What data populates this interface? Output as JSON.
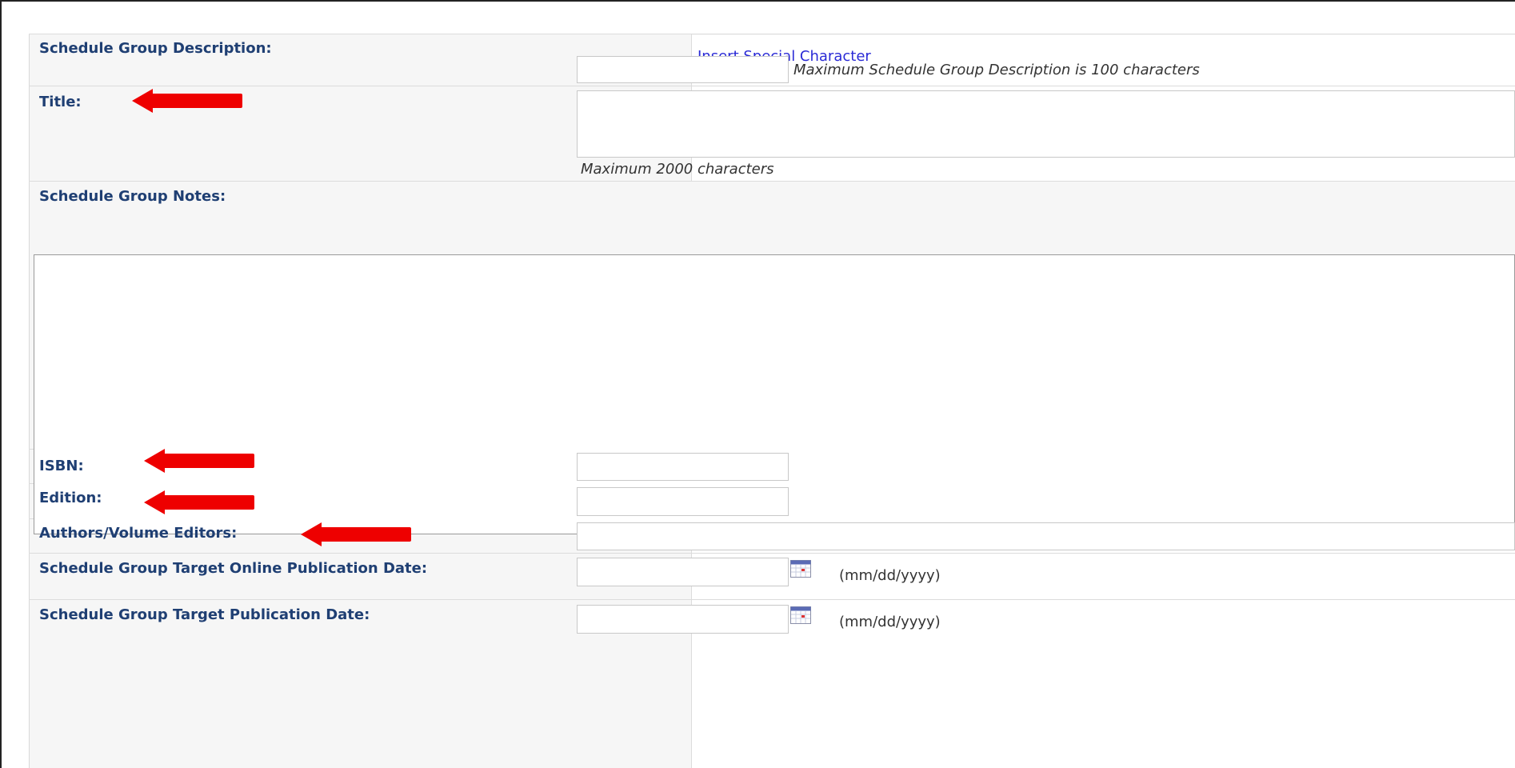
{
  "form": {
    "rows": {
      "description": {
        "label": "Schedule Group Description:",
        "link": "Insert Special Character",
        "hint": "Maximum Schedule Group Description is 100 characters"
      },
      "title": {
        "label": "Title:",
        "hint": "Maximum 2000 characters"
      },
      "notes": {
        "label": "Schedule Group Notes:"
      },
      "isbn": {
        "label": "ISBN:"
      },
      "edition": {
        "label": "Edition:"
      },
      "authors": {
        "label": "Authors/Volume Editors:"
      },
      "online_date": {
        "label": "Schedule Group Target Online Publication Date:",
        "format": "(mm/dd/yyyy)"
      },
      "pub_date": {
        "label": "Schedule Group Target Publication Date:",
        "format": "(mm/dd/yyyy)"
      }
    },
    "values": {
      "description": "",
      "title": "",
      "notes": "",
      "isbn": "",
      "edition": "",
      "authors": "",
      "online_date": "",
      "pub_date": ""
    }
  },
  "annotations": {
    "arrow_color": "#ee0000",
    "targets": [
      "title",
      "isbn",
      "edition",
      "authors"
    ]
  },
  "icons": {
    "calendar": "calendar-icon"
  }
}
